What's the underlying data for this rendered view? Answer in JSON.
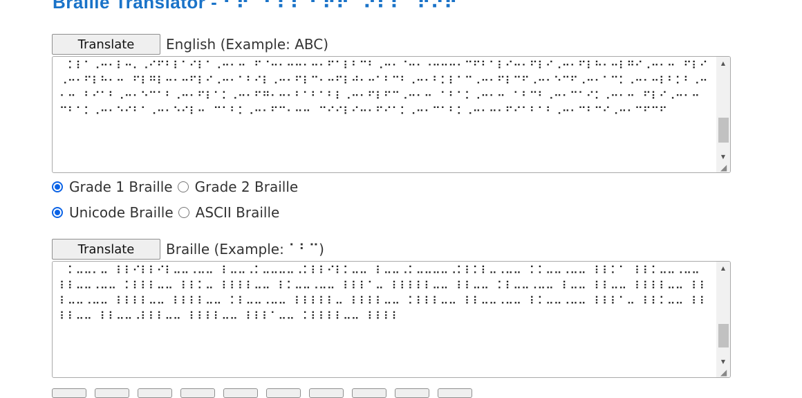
{
  "page": {
    "title": "Braille Translator - ⠃⠗⠁⠊⠇⠇⠑ ⠞⠗⠁⠝⠎⠇⠁⠞⠕⠗"
  },
  "english": {
    "button": "Translate",
    "label": "English (Example: ABC)",
    "text": "⠀⠅⠇⠁⠠⠒⠂⠇⠒⠄⠠⠊⠋⠃⠇⠁⠊⠇⠁⠠⠒⠂⠒⠀⠋⠈⠒⠂⠒⠒⠂⠒⠂⠋⠁⠇⠃⠉⠃⠠⠒⠂⠈⠒⠂⠐⠒⠒⠒⠂⠉⠋⠃⠁⠇⠊⠒⠂⠋⠇⠊⠠⠒⠂⠋⠇⠓⠂⠒⠇⠛⠊⠠⠒⠂⠒⠀⠋⠇⠊⠠⠒⠂⠋⠇⠓⠂⠒⠀⠋⠇⠛⠇⠒⠂⠒⠋⠇⠊⠠⠒⠂⠁⠃⠊⠇⠠⠒⠂⠋⠇⠉⠂⠒⠋⠇⠚⠂⠒⠁⠃⠉⠃⠠⠒⠂⠃⠅⠇⠁⠉⠠⠒⠂⠋⠇⠉⠋⠠⠒⠂⠑⠉⠋⠠⠒⠂⠁⠉⠅⠠⠒⠂⠒⠇⠃⠅⠃⠠⠒⠂⠒⠀⠃⠊⠁⠃⠠⠒⠂⠑⠉⠁⠃⠠⠒⠂⠋⠇⠁⠅⠠⠒⠂⠋⠛⠂⠒⠂⠃⠁⠃⠁⠃⠇⠠⠒⠂⠋⠇⠋⠉⠠⠒⠂⠒⠀⠁⠃⠁⠅⠠⠒⠂⠒⠀⠁⠃⠉⠃⠠⠒⠂⠉⠁⠊⠅⠠⠒⠂⠒⠀⠋⠇⠊⠠⠒⠂⠒⠀⠉⠃⠁⠅⠠⠒⠂⠑⠊⠃⠁⠠⠒⠂⠑⠊⠇⠒⠀⠉⠁⠃⠅⠠⠒⠂⠋⠉⠂⠒⠒⠀⠉⠊⠊⠇⠊⠒⠂⠋⠊⠁⠅⠠⠒⠂⠉⠁⠃⠅⠠⠒⠂⠒⠂⠋⠊⠁⠃⠁⠃⠠⠒⠂⠉⠃⠉⠊⠠⠒⠂⠉⠋⠉⠋",
    "mode_grade1": "Grade 1 Braille",
    "mode_grade2": "Grade 2 Braille",
    "mode_unicode": "Unicode Braille",
    "mode_ascii": "ASCII Braille"
  },
  "braille": {
    "button": "Translate",
    "label": "Braille (Example: ⠁⠃⠉)",
    "text": "⠀⠅⠤⠤⠄⠤⠀⠇⠇⠊⠇⠇⠊⠇⠤⠤⠠⠤⠤⠀⠇⠤⠤⠠⠅⠤⠤⠤⠤⠠⠅⠇⠇⠊⠇⠅⠤⠤⠀⠇⠤⠤⠠⠅⠤⠤⠤⠤⠠⠅⠇⠅⠇⠤⠠⠤⠤⠀⠅⠅⠤⠤⠠⠤⠤⠀⠇⠇⠅⠁⠀⠇⠇⠅⠤⠤⠠⠤⠤⠀⠇⠇⠤⠤⠠⠤⠤⠀⠅⠇⠇⠇⠤⠤⠀⠇⠇⠅⠤⠀⠇⠇⠇⠇⠤⠤⠀⠇⠅⠤⠤⠠⠤⠤⠀⠇⠇⠇⠁⠤⠀⠇⠇⠇⠇⠇⠤⠤⠀⠇⠇⠤⠤⠀⠅⠇⠤⠤⠠⠤⠤⠀⠇⠤⠤⠀⠇⠇⠤⠤⠀⠇⠇⠇⠇⠤⠤⠀⠇⠇⠇⠤⠤⠠⠤⠤⠀⠇⠇⠇⠇⠤⠤⠀⠇⠇⠇⠇⠤⠤⠀⠅⠇⠤⠤⠠⠤⠤⠀⠇⠇⠇⠇⠇⠤⠀⠇⠇⠇⠇⠤⠤⠀⠅⠇⠇⠇⠤⠤⠀⠇⠇⠤⠤⠠⠤⠤⠀⠇⠅⠤⠤⠠⠤⠤⠀⠇⠇⠇⠁⠤⠀⠇⠇⠅⠤⠤⠀⠇⠇⠇⠇⠤⠤⠀⠇⠇⠤⠤⠠⠇⠇⠇⠤⠤⠀⠇⠇⠇⠇⠤⠤⠀⠇⠇⠇⠁⠤⠤⠀⠅⠇⠇⠇⠇⠤⠤⠀⠇⠇⠇⠇"
  },
  "colors": {
    "title": "#1a73c8",
    "radio_checked": "#0b63e6"
  }
}
